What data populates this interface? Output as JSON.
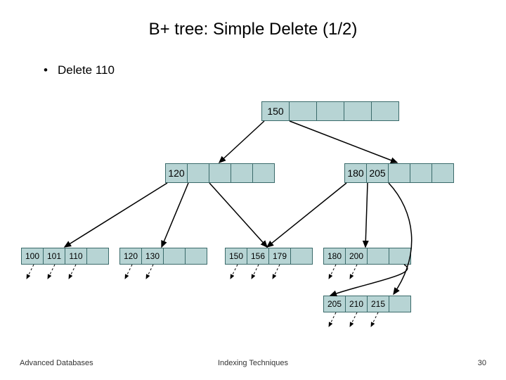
{
  "title": "B+ tree: Simple Delete (1/2)",
  "bullet": "Delete 110",
  "root": {
    "cells": [
      "150",
      "",
      "",
      "",
      ""
    ]
  },
  "internal_left": {
    "cells": [
      "120",
      "",
      "",
      "",
      ""
    ]
  },
  "internal_right": {
    "cells": [
      "180",
      "205",
      "",
      "",
      ""
    ]
  },
  "leaves": [
    {
      "cells": [
        "100",
        "101",
        "110",
        ""
      ]
    },
    {
      "cells": [
        "120",
        "130",
        "",
        ""
      ]
    },
    {
      "cells": [
        "150",
        "156",
        "179",
        ""
      ]
    },
    {
      "cells": [
        "180",
        "200",
        "",
        ""
      ]
    },
    {
      "cells": [
        "205",
        "210",
        "215",
        ""
      ]
    }
  ],
  "footer": {
    "left": "Advanced Databases",
    "center": "Indexing Techniques",
    "right": "30"
  }
}
